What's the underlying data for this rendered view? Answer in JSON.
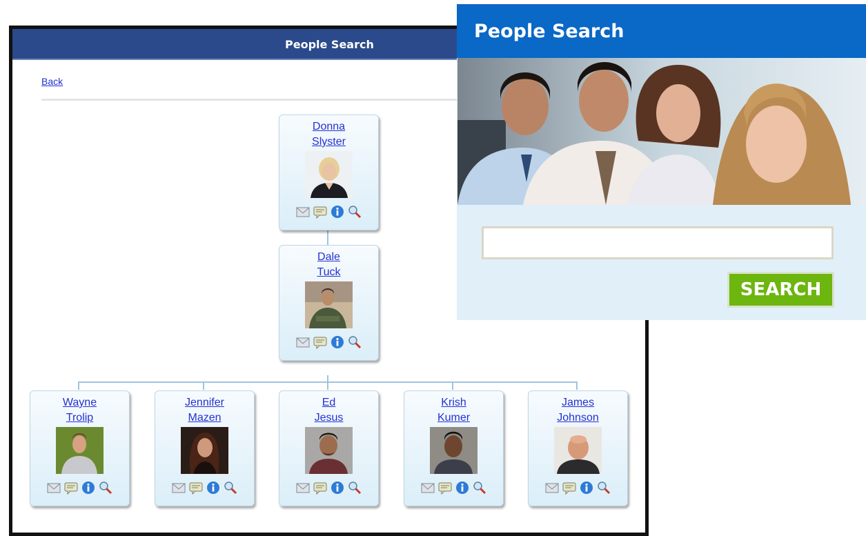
{
  "org_chart": {
    "title": "People Search",
    "back_label": "Back",
    "root": {
      "first": "Donna",
      "last": "Slyster"
    },
    "manager": {
      "first": "Dale",
      "last": "Tuck"
    },
    "reports": [
      {
        "first": "Wayne",
        "last": "Trolip"
      },
      {
        "first": "Jennifer",
        "last": "Mazen"
      },
      {
        "first": "Ed",
        "last": "Jesus"
      },
      {
        "first": "Krish",
        "last": "Kumer"
      },
      {
        "first": "James",
        "last": "Johnson"
      }
    ],
    "card_actions": [
      "email-icon",
      "message-icon",
      "info-icon",
      "search-icon"
    ]
  },
  "search_panel": {
    "title": "People Search",
    "input_value": "",
    "input_placeholder": "",
    "button_label": "SEARCH"
  },
  "colors": {
    "org_header": "#2b4a8c",
    "search_header": "#0a68c6",
    "search_button": "#6db50f",
    "link": "#2431d0",
    "card_bg": "#dbeef8"
  }
}
